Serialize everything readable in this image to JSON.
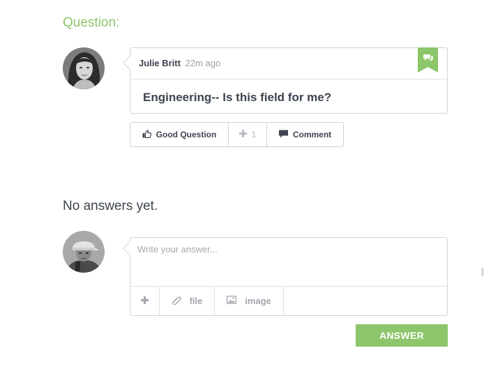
{
  "section": {
    "question_label": "Question:"
  },
  "question": {
    "author": "Julie Britt",
    "time": "22m ago",
    "title": "Engineering-- Is this field for me?"
  },
  "actions": {
    "good_question": "Good Question",
    "plus_count": "1",
    "comment": "Comment"
  },
  "answers": {
    "empty_text": "No answers yet."
  },
  "answer_form": {
    "placeholder": "Write your answer...",
    "value": "",
    "file_label": "file",
    "image_label": "image",
    "submit_label": "ANSWER"
  },
  "colors": {
    "accent": "#8cc56a",
    "text": "#3d4450",
    "muted": "#a3a8ae",
    "border": "#cfd2d6"
  },
  "icons": {
    "ribbon": "chat-bubbles-icon",
    "good_question": "thumbs-up-icon",
    "plus": "plus-icon",
    "comment": "comment-bubble-icon",
    "add": "plus-icon",
    "file": "paperclip-icon",
    "image": "image-icon"
  }
}
